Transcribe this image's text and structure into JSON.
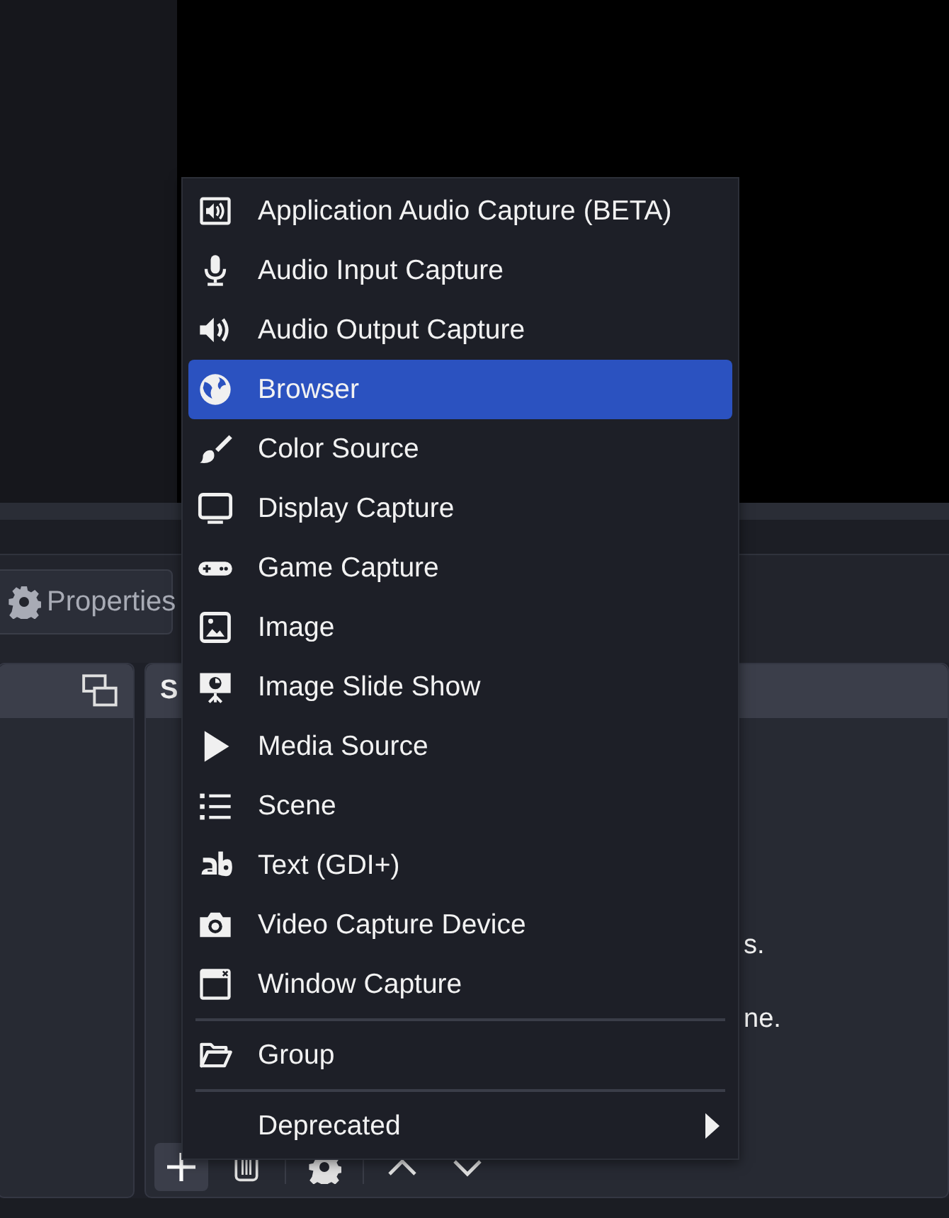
{
  "properties_button": {
    "label": "Properties"
  },
  "sources_dock": {
    "title": "S",
    "text_lines": [
      "s.",
      "ne."
    ]
  },
  "add_menu": {
    "sections": [
      [
        {
          "label": "Application Audio Capture (BETA)",
          "selected": false
        },
        {
          "label": "Audio Input Capture",
          "selected": false
        },
        {
          "label": "Audio Output Capture",
          "selected": false
        },
        {
          "label": "Browser",
          "selected": true
        },
        {
          "label": "Color Source",
          "selected": false
        },
        {
          "label": "Display Capture",
          "selected": false
        },
        {
          "label": "Game Capture",
          "selected": false
        },
        {
          "label": "Image",
          "selected": false
        },
        {
          "label": "Image Slide Show",
          "selected": false
        },
        {
          "label": "Media Source",
          "selected": false
        },
        {
          "label": "Scene",
          "selected": false
        },
        {
          "label": "Text (GDI+)",
          "selected": false
        },
        {
          "label": "Video Capture Device",
          "selected": false
        },
        {
          "label": "Window Capture",
          "selected": false
        }
      ],
      [
        {
          "label": "Group",
          "selected": false
        }
      ],
      [
        {
          "label": "Deprecated",
          "selected": false,
          "submenu": true
        }
      ]
    ]
  }
}
